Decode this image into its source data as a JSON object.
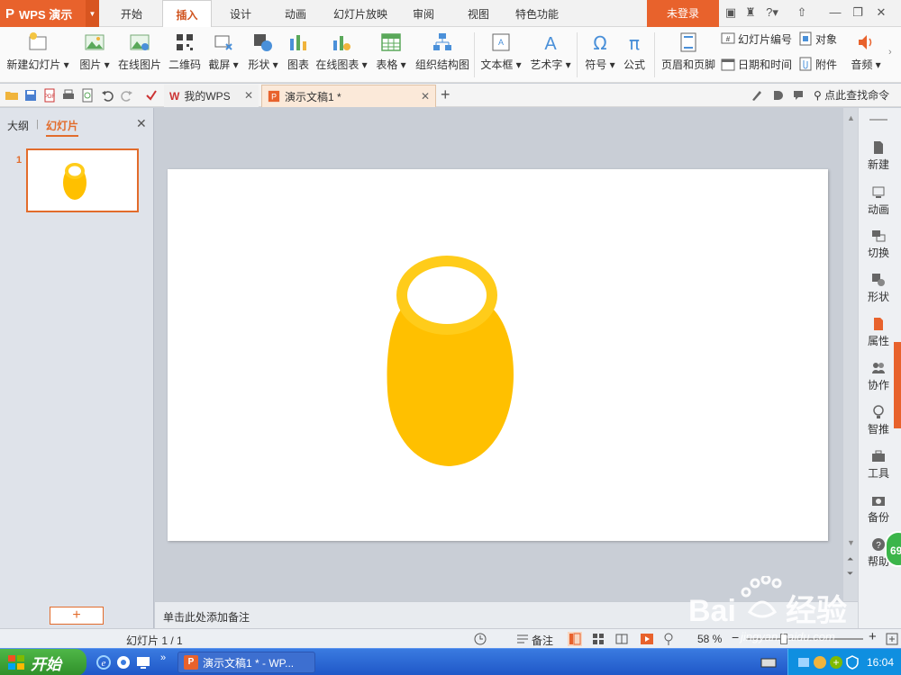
{
  "app": {
    "name": "WPS 演示",
    "login": "未登录"
  },
  "menu": [
    "开始",
    "插入",
    "设计",
    "动画",
    "幻灯片放映",
    "审阅",
    "视图",
    "特色功能"
  ],
  "active_menu": "插入",
  "ribbon": {
    "new_slide": "新建幻灯片",
    "picture": "图片",
    "online_picture": "在线图片",
    "qrcode": "二维码",
    "screenshot": "截屏",
    "shape": "形状",
    "chart": "图表",
    "online_chart": "在线图表",
    "table": "表格",
    "org_chart": "组织结构图",
    "textbox": "文本框",
    "wordart": "艺术字",
    "symbol": "符号",
    "formula": "公式",
    "header_footer": "页眉和页脚",
    "slide_number": "幻灯片编号",
    "object": "对象",
    "datetime": "日期和时间",
    "attachment": "附件",
    "audio": "音频"
  },
  "tabs": {
    "mywps": "我的WPS",
    "doc": "演示文稿1 *"
  },
  "find_command": "点此查找命令",
  "left_panel": {
    "outline": "大纲",
    "slides": "幻灯片",
    "slide_number": "1"
  },
  "notes_placeholder": "单击此处添加备注",
  "right_panel": [
    "新建",
    "动画",
    "切换",
    "形状",
    "属性",
    "协作",
    "智推",
    "工具",
    "备份",
    "帮助"
  ],
  "status": {
    "slide": "幻灯片 1 / 1",
    "notes": "备注",
    "zoom": "58 %",
    "zoom_fraction": 0.58
  },
  "taskbar": {
    "start": "开始",
    "task": "演示文稿1 * - WP...",
    "time": "16:04"
  },
  "badge": "69",
  "watermark": {
    "url": "jingyan.baidu.com"
  },
  "colors": {
    "accent": "#e8622c",
    "shape": "#ffc000",
    "ring": "#ffcc1a"
  }
}
